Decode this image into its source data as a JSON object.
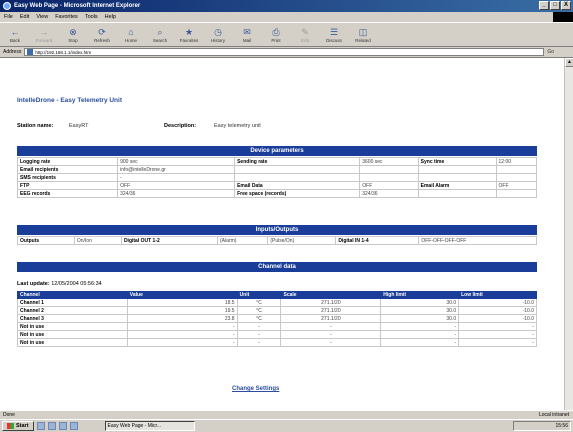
{
  "window": {
    "title": "Easy Web Page - Microsoft Internet Explorer",
    "controls": [
      "_",
      "□",
      "X"
    ]
  },
  "menu": [
    "File",
    "Edit",
    "View",
    "Favorites",
    "Tools",
    "Help"
  ],
  "toolbar": [
    {
      "label": "Back",
      "glyph": "←",
      "disabled": false
    },
    {
      "label": "Forward",
      "glyph": "→",
      "disabled": true
    },
    {
      "label": "Stop",
      "glyph": "⊗",
      "disabled": false
    },
    {
      "label": "Refresh",
      "glyph": "⟳",
      "disabled": false
    },
    {
      "label": "Home",
      "glyph": "⌂",
      "disabled": false
    },
    {
      "label": "Search",
      "glyph": "⌕",
      "disabled": false
    },
    {
      "label": "Favorites",
      "glyph": "★",
      "disabled": false
    },
    {
      "label": "History",
      "glyph": "◷",
      "disabled": false
    },
    {
      "label": "Mail",
      "glyph": "✉",
      "disabled": false
    },
    {
      "label": "Print",
      "glyph": "⎙",
      "disabled": false
    },
    {
      "label": "Edit",
      "glyph": "✎",
      "disabled": true
    },
    {
      "label": "Discuss",
      "glyph": "☰",
      "disabled": false
    },
    {
      "label": "Related",
      "glyph": "◫",
      "disabled": false
    }
  ],
  "address": {
    "label": "Address",
    "value": "http://192.168.1.1/index.htm",
    "go": "Go"
  },
  "page": {
    "title": "IntelleDrone - Easy Telemetry Unit",
    "station_label": "Station name:",
    "station_value": "EasyRT",
    "desc_label": "Description:",
    "desc_value": "Easy telemetry unit",
    "device_head": "Device parameters",
    "device_rows": [
      [
        "Logging rate",
        "900 sec",
        "Sending rate",
        "3600 sec",
        "Sync time",
        "12:00"
      ],
      [
        "Email recipients",
        "info@intelleDrone.gr",
        "",
        "",
        "",
        ""
      ],
      [
        "SMS recipients",
        "-",
        "",
        "",
        "",
        ""
      ],
      [
        "FTP",
        "OFF",
        "Email Data",
        "OFF",
        "Email Alarm",
        "OFF"
      ],
      [
        "EEG records",
        "324/36",
        "Free space (records)",
        "324/36",
        "",
        ""
      ]
    ],
    "io_head": "Inputs/Outputs",
    "io_row": [
      "Outputs",
      "On/Ion",
      "Digital OUT 1-2",
      "(Alarm)",
      "(Pulse/On)",
      "Digital IN 1-4",
      "OFF-OFF-OFF-OFF"
    ],
    "channel_head": "Channel data",
    "last_update_label": "Last update:",
    "last_update_value": "12/05/2004 05:56:34",
    "channel_cols": [
      "Channel",
      "Value",
      "Unit",
      "Scale",
      "High limit",
      "Low limit"
    ],
    "channels": [
      [
        "Channel 1",
        "18.5",
        "°C",
        "271.1/20",
        "30.0",
        "-10.0"
      ],
      [
        "Channel 2",
        "19.5",
        "°C",
        "271.1/20",
        "30.0",
        "-10.0"
      ],
      [
        "Channel 3",
        "23.8",
        "°C",
        "271.1/20",
        "30.0",
        "-10.0"
      ],
      [
        "Not in use",
        "-",
        "-",
        "-",
        "-",
        "-"
      ],
      [
        "Not in use",
        "-",
        "-",
        "-",
        "-",
        "-"
      ],
      [
        "Not in use",
        "-",
        "-",
        "-",
        "-",
        "-"
      ]
    ],
    "change_link": "Change Settings"
  },
  "status": {
    "text": "Done",
    "zone": "Local intranet"
  },
  "taskbar": {
    "start": "Start",
    "task": "Easy Web Page - Micr...",
    "clock": "15:56"
  }
}
